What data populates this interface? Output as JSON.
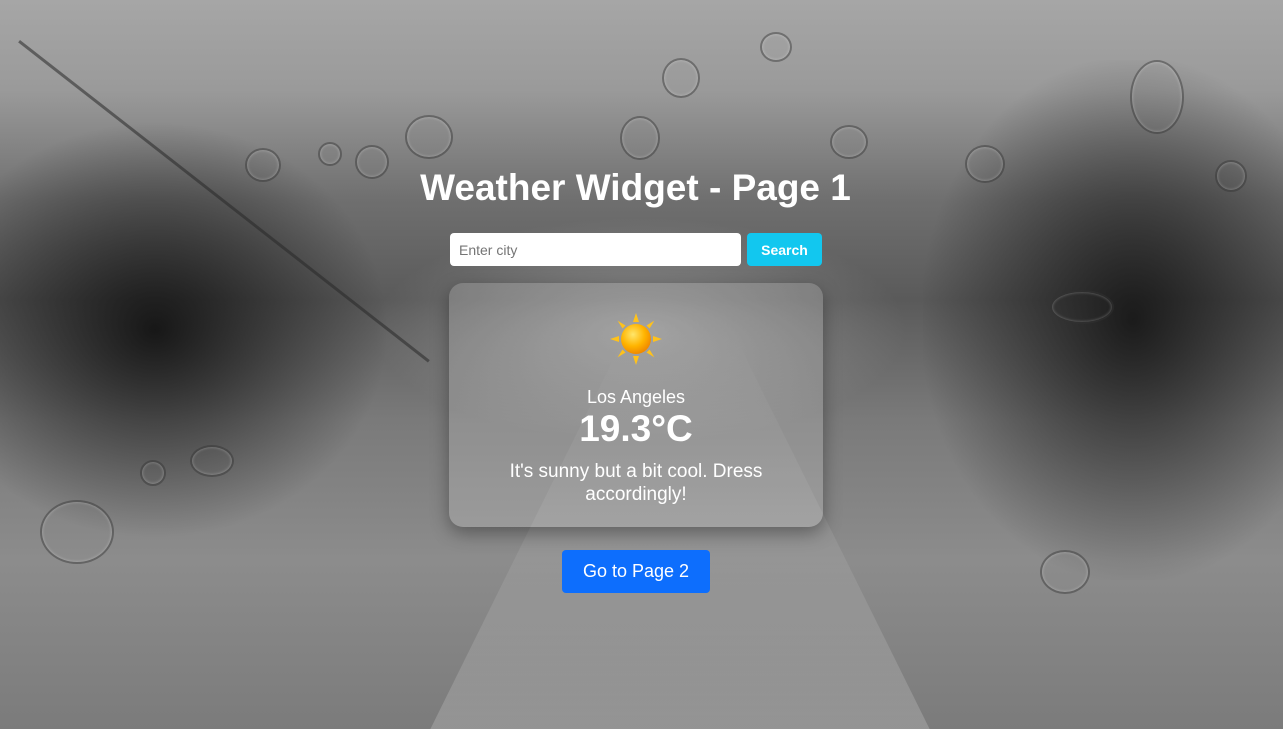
{
  "page": {
    "title": "Weather Widget - Page 1"
  },
  "search": {
    "placeholder": "Enter city",
    "value": "",
    "button_label": "Search"
  },
  "weather": {
    "icon": "sun-icon",
    "city": "Los Angeles",
    "temperature": "19.3°C",
    "description": "It's sunny but a bit cool. Dress accordingly!"
  },
  "navigation": {
    "next_page_label": "Go to Page 2"
  },
  "colors": {
    "search_button": "#12c7ef",
    "page_button": "#0d6efd",
    "text": "#ffffff"
  }
}
